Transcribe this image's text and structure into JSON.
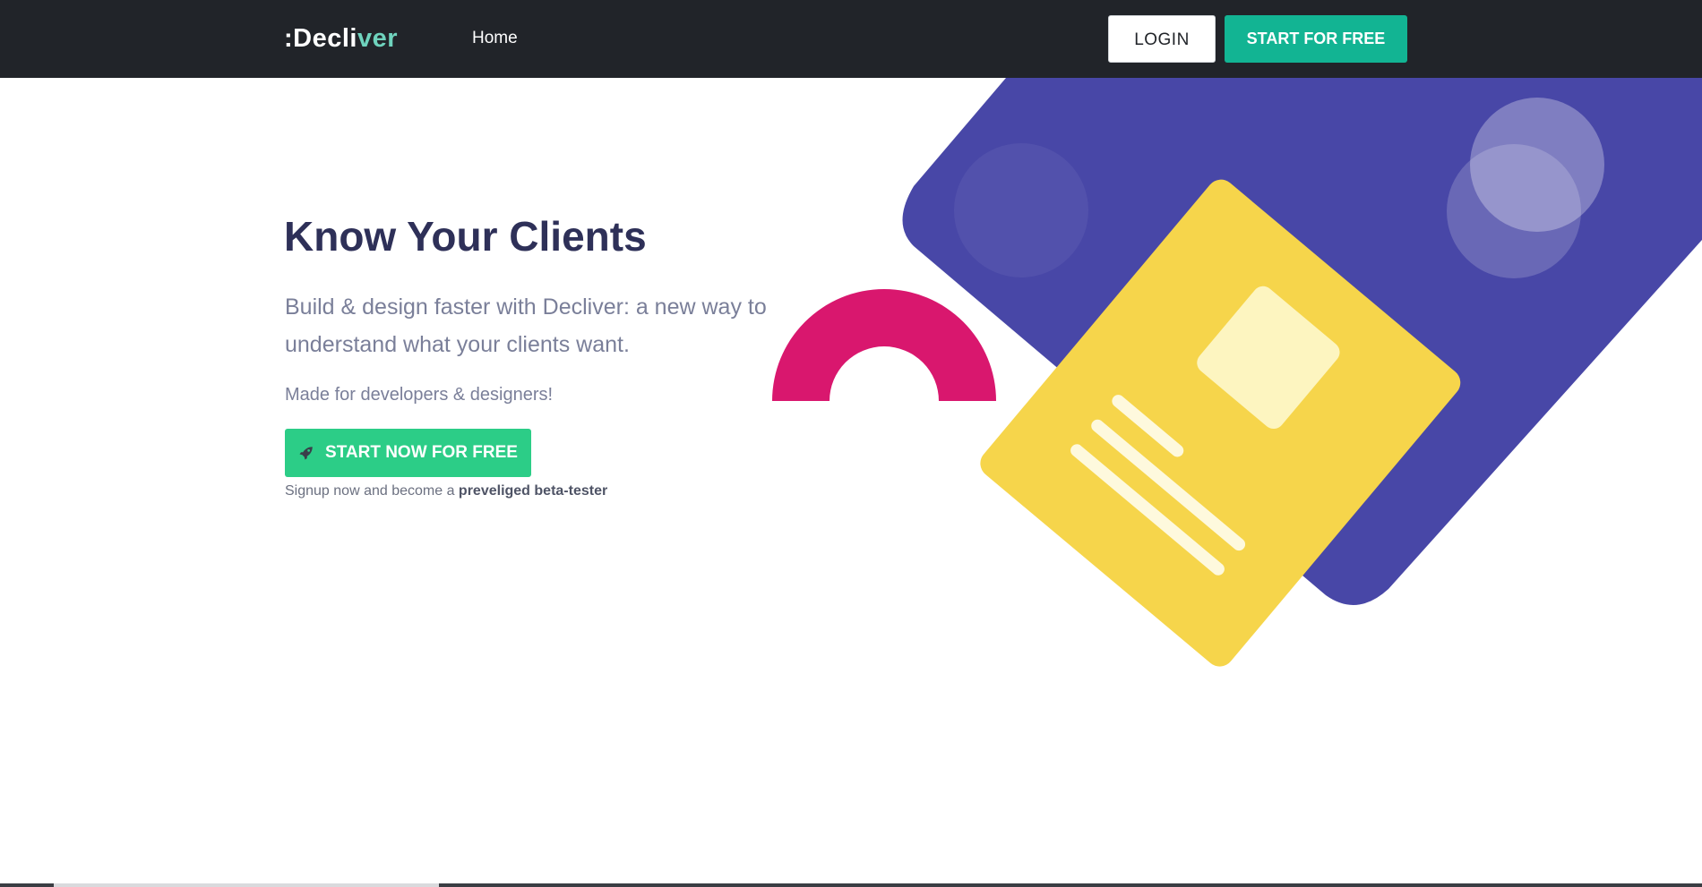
{
  "header": {
    "logo": {
      "prefix": ":Decli",
      "accent": "ver"
    },
    "nav": {
      "home": "Home"
    },
    "login_label": "LOGIN",
    "start_label": "START FOR FREE"
  },
  "hero": {
    "title": "Know Your Clients",
    "subtitle": "Build & design faster with Decliver: a new way to understand what your clients want.",
    "audience": "Made for developers & designers!",
    "cta_label": "START NOW FOR FREE",
    "cta_icon": "rocket-icon",
    "signup_text": "Signup now and become a ",
    "signup_bold": "preveliged beta-tester"
  },
  "colors": {
    "topbar": "#212429",
    "brand_teal": "#12b493",
    "cta_green": "#2ccd87",
    "title_navy": "#2e3058",
    "illustration_purple": "#4847a7",
    "illustration_yellow": "#f6d54b",
    "illustration_pink": "#d9176e"
  }
}
